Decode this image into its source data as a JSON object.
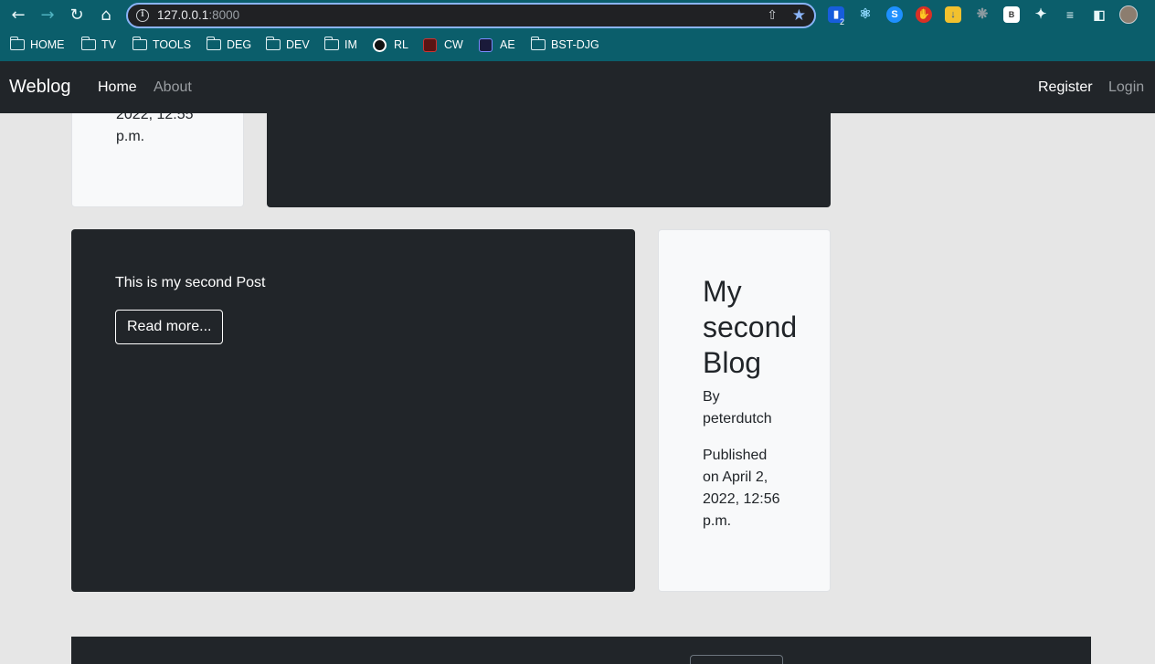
{
  "browser": {
    "url_host": "127.0.0.1",
    "url_port": ":8000",
    "extension_badge": "2",
    "bookmarks": [
      {
        "label": "HOME",
        "type": "folder"
      },
      {
        "label": "TV",
        "type": "folder"
      },
      {
        "label": "TOOLS",
        "type": "folder"
      },
      {
        "label": "DEG",
        "type": "folder"
      },
      {
        "label": "DEV",
        "type": "folder"
      },
      {
        "label": "IM",
        "type": "folder"
      },
      {
        "label": "RL",
        "type": "site"
      },
      {
        "label": "CW",
        "type": "site"
      },
      {
        "label": "AE",
        "type": "site"
      },
      {
        "label": "BST-DJG",
        "type": "folder"
      }
    ]
  },
  "navbar": {
    "brand": "Weblog",
    "links": [
      "Home",
      "About"
    ],
    "right_links": [
      "Register",
      "Login"
    ]
  },
  "posts": [
    {
      "published_tail_1": "2022, 12:55",
      "published_tail_2": "p.m."
    },
    {
      "body": "This is my second Post",
      "read_more": "Read more...",
      "title_lines": [
        "My",
        "second",
        "Blog"
      ],
      "by_label": "By",
      "author": "peterdutch",
      "published_lines": [
        "Published",
        "on April 2,",
        "2022, 12:56",
        "p.m."
      ]
    }
  ],
  "colors": {
    "browser_bar": "#0b5e6b",
    "navbar": "#212529",
    "card_light": "#f8f9fa",
    "page_bg": "#e6e6e6",
    "accent": "#8ab4f8"
  }
}
